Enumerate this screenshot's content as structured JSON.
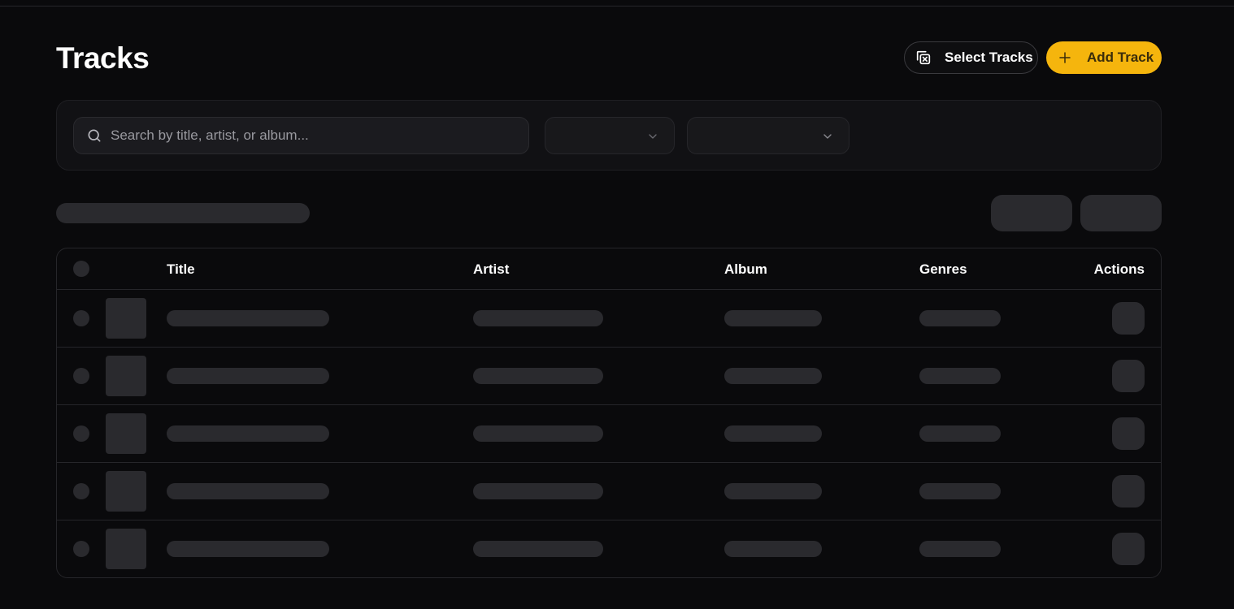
{
  "page": {
    "title": "Tracks"
  },
  "header": {
    "select_tracks_label": "Select Tracks",
    "add_track_label": "Add Track",
    "select_icon": "select-multiple-icon",
    "add_icon": "plus-icon"
  },
  "filters": {
    "search": {
      "placeholder": "Search by title, artist, or album...",
      "value": ""
    },
    "genre_select": {
      "value": ""
    },
    "sort_select": {
      "value": ""
    }
  },
  "table": {
    "columns": [
      "Title",
      "Artist",
      "Album",
      "Genres",
      "Actions"
    ],
    "loading": true
  },
  "colors": {
    "accent": "#f5b50d",
    "background": "#0a0a0c",
    "panel": "#111114",
    "skeleton": "#2a2a2e"
  }
}
